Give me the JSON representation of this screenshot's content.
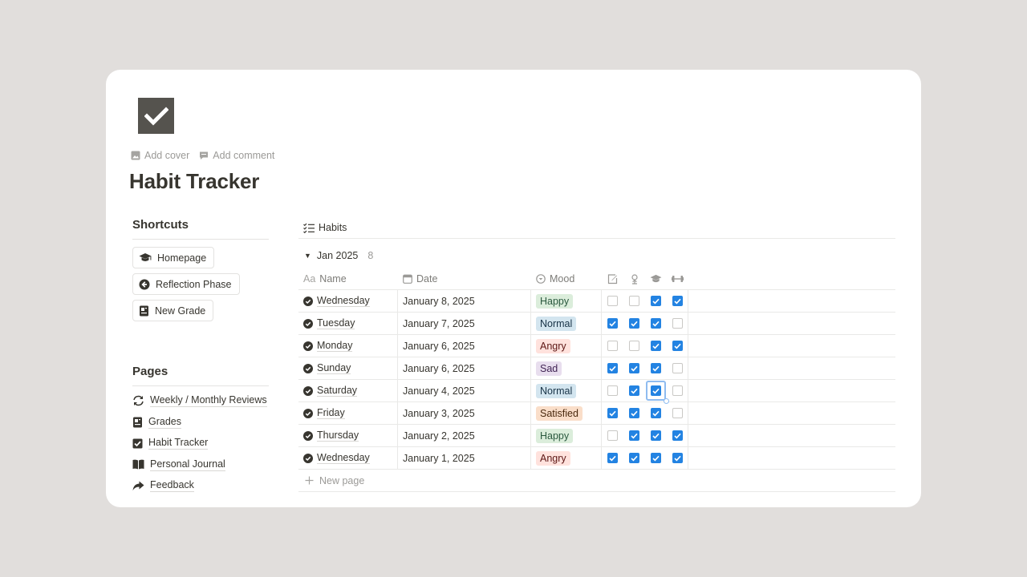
{
  "page": {
    "title": "Habit Tracker",
    "add_cover": "Add cover",
    "add_comment": "Add comment"
  },
  "sidebar": {
    "shortcuts_title": "Shortcuts",
    "shortcuts": [
      {
        "label": "Homepage",
        "icon": "graduation-cap-icon"
      },
      {
        "label": "Reflection Phase",
        "icon": "arrow-circle-left-icon"
      },
      {
        "label": "New Grade",
        "icon": "report-icon"
      }
    ],
    "pages_title": "Pages",
    "pages": [
      {
        "label": "Weekly / Monthly Reviews",
        "icon": "refresh-icon"
      },
      {
        "label": "Grades",
        "icon": "report-icon"
      },
      {
        "label": "Habit Tracker",
        "icon": "checkbox-icon"
      },
      {
        "label": "Personal Journal",
        "icon": "book-icon"
      },
      {
        "label": "Feedback",
        "icon": "share-arrow-icon"
      }
    ]
  },
  "database": {
    "view_name": "Habits",
    "group_label": "Jan 2025",
    "group_count": "8",
    "columns": {
      "name": "Name",
      "date": "Date",
      "mood": "Mood",
      "name_prefix": "Aa"
    },
    "habit_icons": [
      "pencil-icon",
      "person-icon",
      "graduation-cap-icon",
      "dumbbell-icon"
    ],
    "rows": [
      {
        "name": "Wednesday",
        "date": "January 8, 2025",
        "mood": "Happy",
        "checks": [
          false,
          false,
          true,
          true
        ]
      },
      {
        "name": "Tuesday",
        "date": "January 7, 2025",
        "mood": "Normal",
        "checks": [
          true,
          true,
          true,
          false
        ]
      },
      {
        "name": "Monday",
        "date": "January 6, 2025",
        "mood": "Angry",
        "checks": [
          false,
          false,
          true,
          true
        ]
      },
      {
        "name": "Sunday",
        "date": "January 6, 2025",
        "mood": "Sad",
        "checks": [
          true,
          true,
          true,
          false
        ]
      },
      {
        "name": "Saturday",
        "date": "January 4, 2025",
        "mood": "Normal",
        "checks": [
          false,
          true,
          true,
          false
        ]
      },
      {
        "name": "Friday",
        "date": "January 3, 2025",
        "mood": "Satisfied",
        "checks": [
          true,
          true,
          true,
          false
        ]
      },
      {
        "name": "Thursday",
        "date": "January 2, 2025",
        "mood": "Happy",
        "checks": [
          false,
          true,
          true,
          true
        ]
      },
      {
        "name": "Wednesday",
        "date": "January 1, 2025",
        "mood": "Angry",
        "checks": [
          true,
          true,
          true,
          true
        ]
      }
    ],
    "new_page": "New page"
  },
  "mood_colors": {
    "Happy": {
      "bg": "#dbeddb",
      "fg": "#2b593f"
    },
    "Normal": {
      "bg": "#d3e5ef",
      "fg": "#183347"
    },
    "Angry": {
      "bg": "#ffe2dd",
      "fg": "#5d1715"
    },
    "Sad": {
      "bg": "#e8deee",
      "fg": "#412454"
    },
    "Satisfied": {
      "bg": "#fadec9",
      "fg": "#49290e"
    }
  },
  "colors": {
    "accent": "#2383e2",
    "background": "#e1dedc",
    "icon_dark": "#55534e"
  }
}
